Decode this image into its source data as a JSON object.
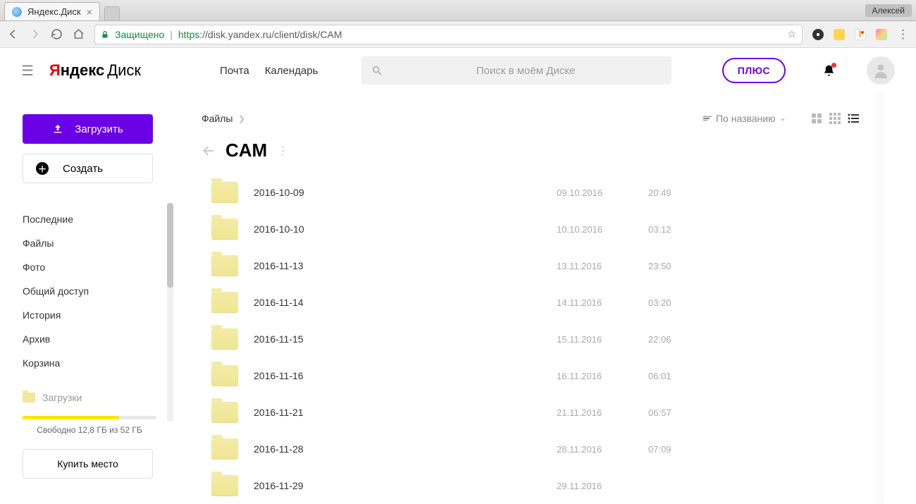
{
  "browser": {
    "tab_title": "Яндекс.Диск",
    "profile_name": "Алексей",
    "secure_label": "Защищено",
    "url_proto": "https",
    "url_rest": "://disk.yandex.ru/client/disk/CAM"
  },
  "header": {
    "logo_letter": "Я",
    "logo_word1": "ндекс",
    "logo_word2": "Диск",
    "link_mail": "Почта",
    "link_cal": "Календарь",
    "search_placeholder": "Поиск в моём Диске",
    "plus_label": "ПЛЮС"
  },
  "sidebar": {
    "upload_label": "Загрузить",
    "create_label": "Создать",
    "nav": {
      "recent": "Последние",
      "files": "Файлы",
      "photo": "Фото",
      "shared": "Общий доступ",
      "history": "История",
      "archive": "Архив",
      "trash": "Корзина",
      "downloads": "Загрузки"
    },
    "storage_text": "Свободно 12,8 ГБ из 52 ГБ",
    "buy_label": "Купить место"
  },
  "main": {
    "breadcrumb_root": "Файлы",
    "sort_label": "По названию",
    "folder_title": "CAM",
    "rows": [
      {
        "name": "2016-10-09",
        "date": "09.10.2016",
        "time": "20:49"
      },
      {
        "name": "2016-10-10",
        "date": "10.10.2016",
        "time": "03:12"
      },
      {
        "name": "2016-11-13",
        "date": "13.11.2016",
        "time": "23:50"
      },
      {
        "name": "2016-11-14",
        "date": "14.11.2016",
        "time": "03:20"
      },
      {
        "name": "2016-11-15",
        "date": "15.11.2016",
        "time": "22:06"
      },
      {
        "name": "2016-11-16",
        "date": "16.11.2016",
        "time": "06:01"
      },
      {
        "name": "2016-11-21",
        "date": "21.11.2016",
        "time": "06:57"
      },
      {
        "name": "2016-11-28",
        "date": "28.11.2016",
        "time": "07:09"
      },
      {
        "name": "2016-11-29",
        "date": "29.11.2016",
        "time": ""
      }
    ]
  }
}
